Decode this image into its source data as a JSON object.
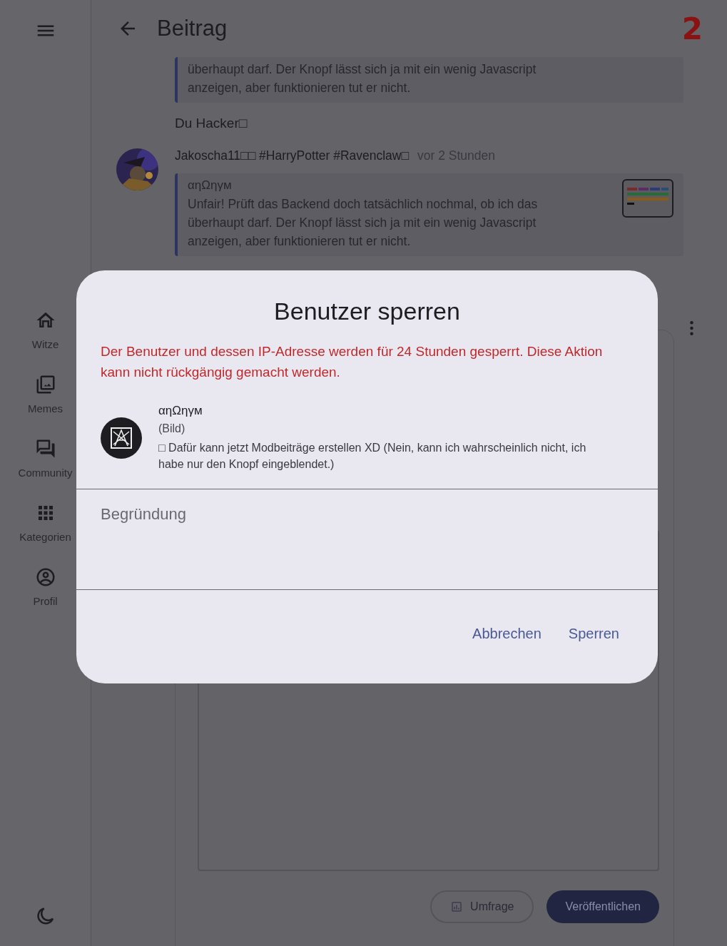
{
  "header": {
    "title": "Beitrag",
    "badge": "2"
  },
  "thread": {
    "quote_top": {
      "text": "überhaupt darf. Der Knopf lässt sich ja mit ein wenig Javascript anzeigen, aber funktionieren tut er nicht."
    },
    "reply": "Du Hacker□",
    "comment": {
      "author": "Jakoscha11□□ #HarryPotter #Ravenclaw□",
      "time": "vor 2 Stunden",
      "quote": {
        "author": "αηΩηγм",
        "text": "Unfair! Prüft das Backend doch tatsächlich nochmal, ob ich das überhaupt darf. Der Knopf lässt sich ja mit ein wenig Javascript anzeigen, aber funktionieren tut er nicht."
      }
    }
  },
  "sidebar": {
    "items": [
      {
        "kind": "home",
        "label": "Witze"
      },
      {
        "kind": "images",
        "label": "Memes"
      },
      {
        "kind": "forum",
        "label": "Community"
      },
      {
        "kind": "grid",
        "label": "Kategorien"
      },
      {
        "kind": "profile",
        "label": "Profil"
      }
    ]
  },
  "composer": {
    "buttons": [
      {
        "kind": "outline",
        "label": "Umfrage"
      },
      {
        "kind": "filled",
        "label": "Veröffentlichen"
      }
    ]
  },
  "dialog": {
    "title": "Benutzer sperren",
    "warning": "Der Benutzer und dessen IP-Adresse werden für 24 Stunden gesperrt. Diese Aktion kann nicht rückgängig gemacht werden.",
    "user": {
      "name": "αηΩηγм",
      "media": "(Bild)",
      "text": "□ Dafür kann jetzt Modbeiträge erstellen XD (Nein, kann ich wahrscheinlich nicht, ich habe nur den Knopf eingeblendet.)"
    },
    "reason": {
      "placeholder": "Begründung"
    },
    "actions": [
      "Abbrechen",
      "Sperren"
    ]
  }
}
